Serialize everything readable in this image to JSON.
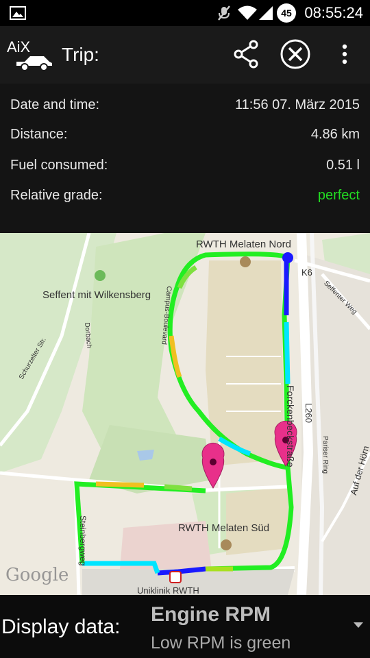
{
  "status_bar": {
    "time": "08:55:24",
    "battery_level": "45",
    "icons": [
      "image-icon",
      "mute-icon",
      "wifi-icon",
      "signal-icon",
      "battery-icon"
    ]
  },
  "action_bar": {
    "logo_text": "AiX",
    "title": "Trip:",
    "icons": [
      "share-icon",
      "close-circle-icon",
      "overflow-menu-icon"
    ]
  },
  "trip_info": {
    "rows": [
      {
        "label": "Date and time:",
        "value": "11:56 07. März 2015"
      },
      {
        "label": "Distance:",
        "value": "4.86 km"
      },
      {
        "label": "Fuel consumed:",
        "value": "0.51 l"
      },
      {
        "label": "Relative grade:",
        "value": "perfect"
      }
    ],
    "grade_color": "#22dd22"
  },
  "map": {
    "labels": {
      "melaten_nord": "RWTH Melaten Nord",
      "seffent": "Seffent mit Wilkensberg",
      "melaten_sued": "RWTH Melaten Süd",
      "k6": "K6",
      "seffenter_weg": "Seffenter Weg",
      "campus_boulevard": "Campus-Boulevard",
      "dorbach": "Dorbach",
      "schurzelter": "Schurzelter Str.",
      "forckenbeckstrasse": "Forckenbeckstraße",
      "l260": "L260",
      "pariser_ring": "Pariser Ring",
      "auf_der_hoern": "Auf der Hörn",
      "steinbergweg": "Steinbergweg",
      "uniklinik": "Uniklinik RWTH"
    },
    "attribution": "Google",
    "route_colors": {
      "low": "#1a1aff",
      "mid": "#00e5ff",
      "good": "#22ee22",
      "high": "#f0c020"
    }
  },
  "bottom_bar": {
    "display_label": "Display data:",
    "selected_main": "Engine RPM",
    "selected_sub": "Low RPM is green"
  }
}
